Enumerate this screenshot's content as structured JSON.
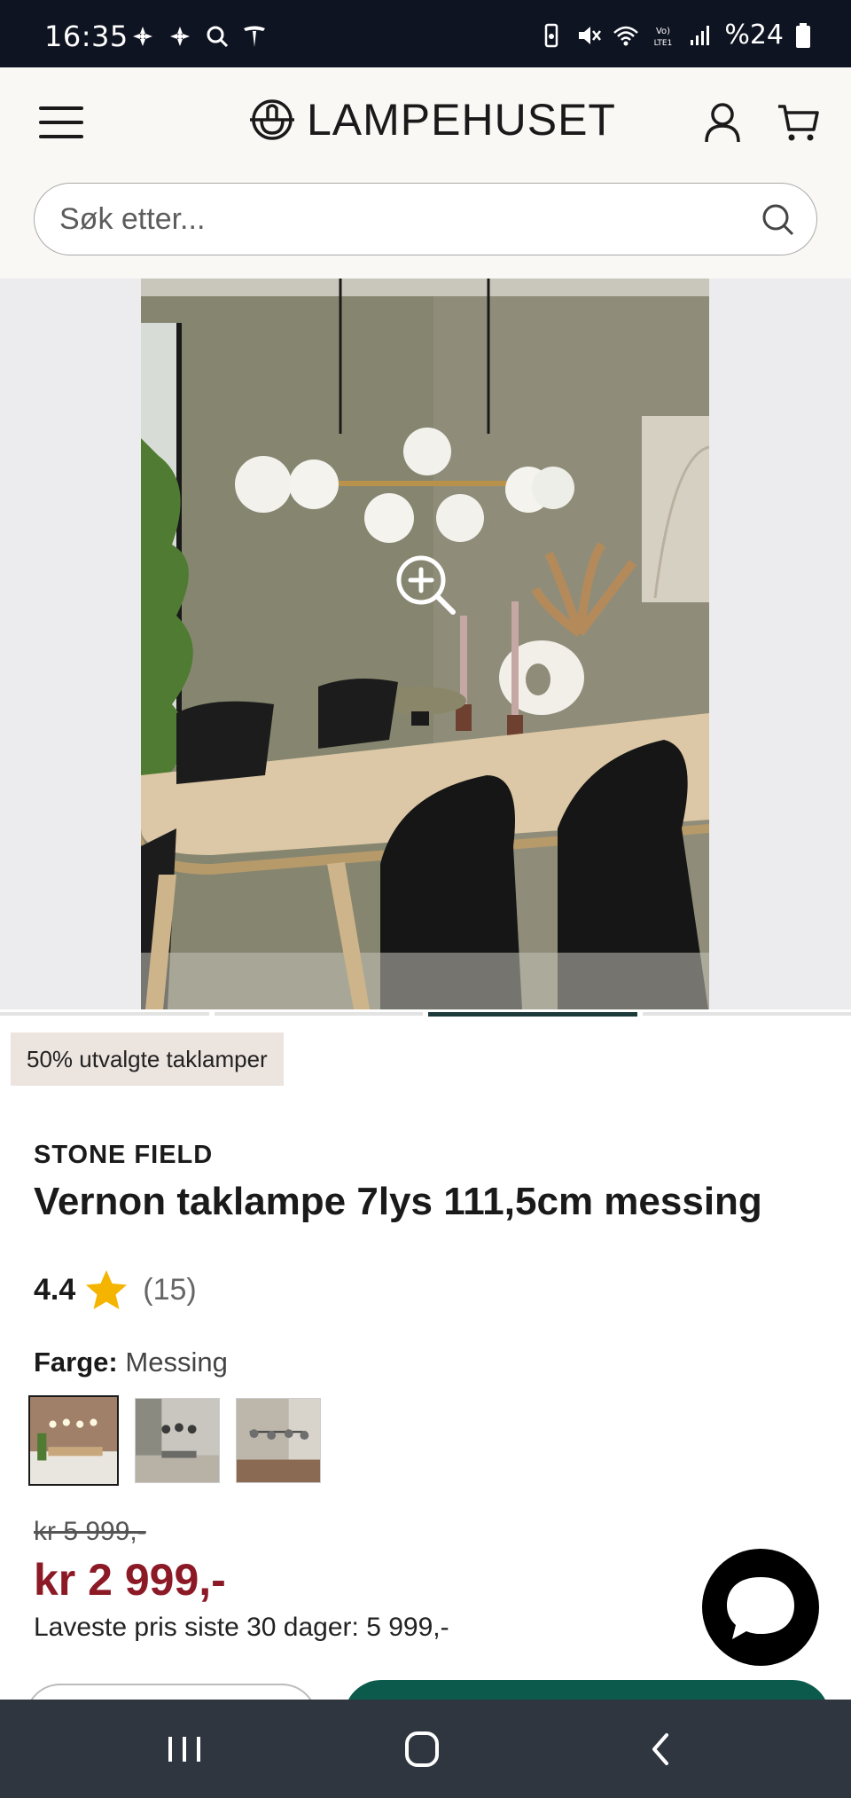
{
  "status_bar": {
    "time": "16:35",
    "battery_text": "%24",
    "left_icons": [
      "fan-icon",
      "fan-icon",
      "search-icon",
      "tesla-icon"
    ],
    "right_icons": [
      "battery-saver-icon",
      "mute-icon",
      "wifi-icon",
      "volte-icon",
      "signal-icon",
      "battery-icon"
    ]
  },
  "header": {
    "brand": "LAMPEHUSET",
    "search_placeholder": "Søk etter..."
  },
  "carousel": {
    "slide_count": 4,
    "active_index": 2
  },
  "badge": "50% utvalgte taklamper",
  "product": {
    "brand": "STONE FIELD",
    "title": "Vernon taklampe 7lys 111,5cm messing",
    "rating": "4.4",
    "review_count": "(15)",
    "color_label": "Farge:",
    "color_value": "Messing",
    "swatch_count": 3,
    "old_price": "kr 5 999,-",
    "price": "kr 2 999,-",
    "lowest_price_note": "Laveste pris siste 30 dager: 5 999,-"
  },
  "colors": {
    "price_red": "#8c1a26",
    "primary_green": "#0b5a4c",
    "header_bg": "#faf8f5",
    "star": "#f5b400"
  }
}
